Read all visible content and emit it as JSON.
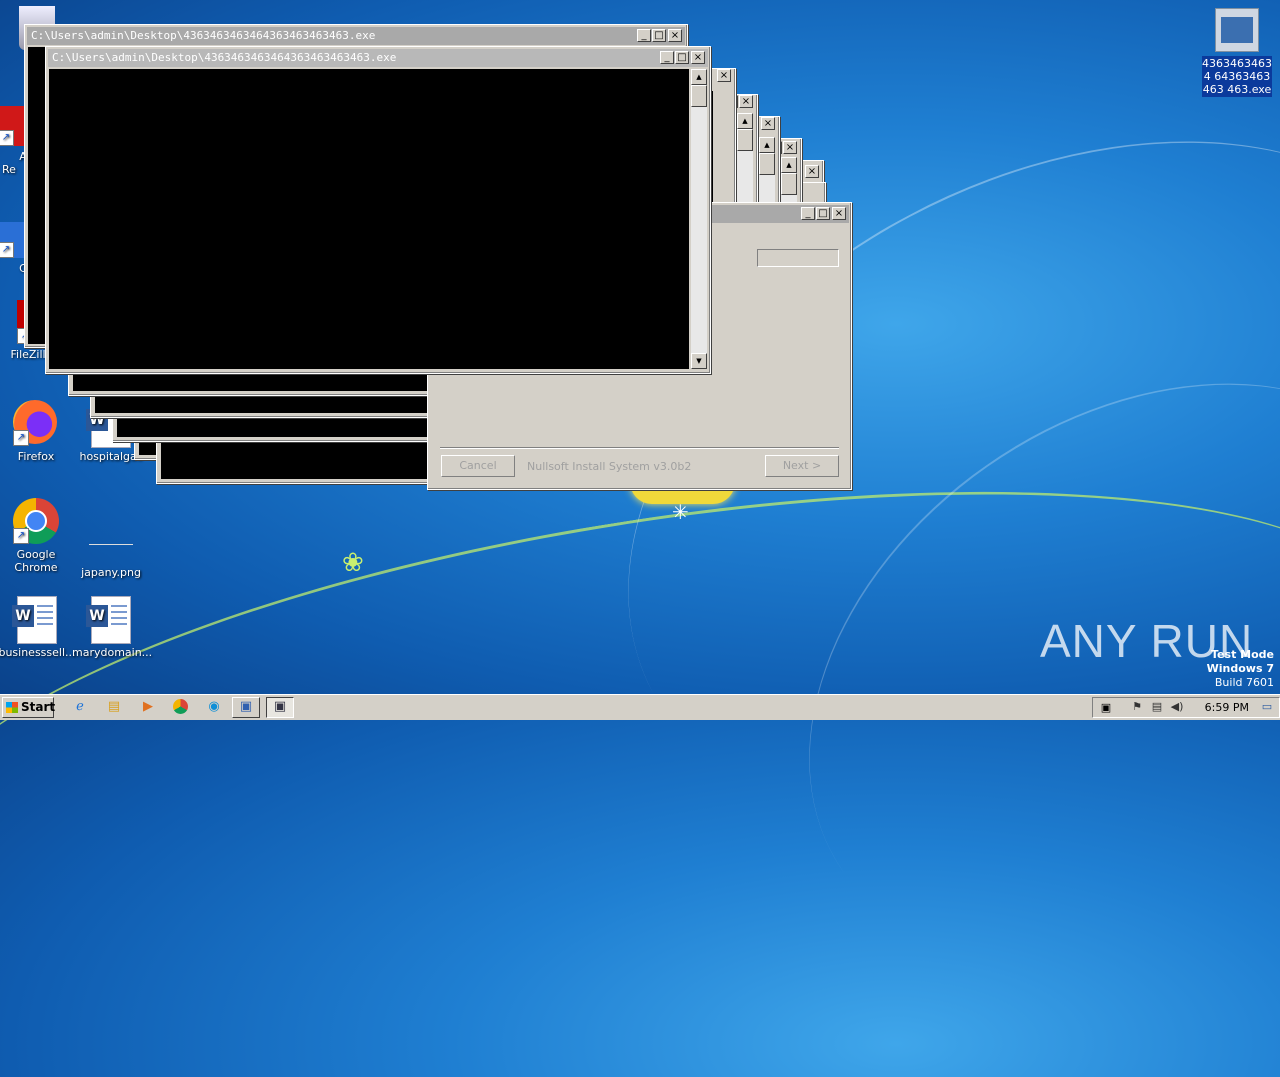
{
  "desktop": {
    "icons": [
      {
        "label": "Re",
        "icon": "recycle-bin-icon"
      },
      {
        "label": "A\nRe",
        "icon": "acrobat-reader-icon"
      },
      {
        "label": "C",
        "icon": "ccleaner-icon"
      },
      {
        "label": "FileZilla C",
        "icon": "filezilla-icon"
      },
      {
        "label": "Firefox",
        "icon": "firefox-icon"
      },
      {
        "label": "hospitalgas",
        "icon": "word-doc-icon"
      },
      {
        "label": "Google\nChrome",
        "icon": "chrome-icon"
      },
      {
        "label": "japany.png",
        "icon": "image-file-icon"
      },
      {
        "label": "businesssell...",
        "icon": "word-doc-icon"
      },
      {
        "label": "marydomain...",
        "icon": "word-doc-icon"
      }
    ],
    "exe_icon_label": "43634634634 64363463463 463.exe"
  },
  "windows": {
    "console_back_title": "C:\\Users\\admin\\Desktop\\4363463463464363463463463.exe",
    "console_front_title": "C:\\Users\\admin\\Desktop\\4363463463464363463463463.exe",
    "minimize_glyph": "_",
    "maximize_glyph": "□",
    "close_glyph": "×",
    "scroll_up_glyph": "▲",
    "scroll_down_glyph": "▼"
  },
  "installer": {
    "cancel_label": "Cancel",
    "branding": "Nullsoft Install System v3.0b2",
    "next_label": "Next >"
  },
  "watermark": {
    "brand": "ANY RUN",
    "test_mode": "Test Mode",
    "os": "Windows 7",
    "build": "Build 7601"
  },
  "taskbar": {
    "start_label": "Start",
    "clock": "6:59 PM"
  }
}
